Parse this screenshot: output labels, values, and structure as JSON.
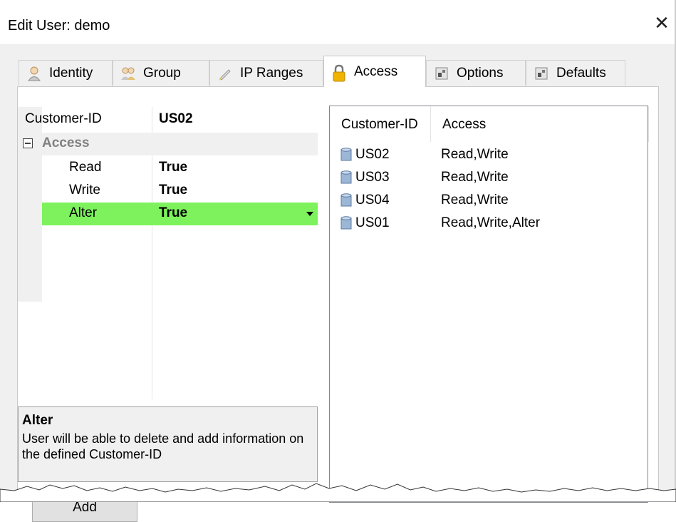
{
  "window": {
    "title": "Edit User: demo",
    "close_glyph": "✕"
  },
  "tabs": [
    {
      "label": "Identity",
      "icon": "person-icon",
      "selected": false
    },
    {
      "label": "Group",
      "icon": "group-icon",
      "selected": false
    },
    {
      "label": "IP Ranges",
      "icon": "pen-icon",
      "selected": false
    },
    {
      "label": "Access",
      "icon": "lock-icon",
      "selected": true
    },
    {
      "label": "Options",
      "icon": "settings-icon",
      "selected": false
    },
    {
      "label": "Defaults",
      "icon": "settings-icon",
      "selected": false
    }
  ],
  "property_grid": {
    "customer_id_label": "Customer-ID",
    "customer_id_value": "US02",
    "category": "Access",
    "rows": [
      {
        "name": "Read",
        "value": "True"
      },
      {
        "name": "Write",
        "value": "True"
      },
      {
        "name": "Alter",
        "value": "True"
      }
    ],
    "selected_row": "Alter",
    "selected_color": "#7df25c"
  },
  "help": {
    "title": "Alter",
    "description": "User will be able to delete and add information on the defined Customer-ID"
  },
  "buttons": {
    "add": "Add"
  },
  "list": {
    "columns": [
      "Customer-ID",
      "Access"
    ],
    "rows": [
      {
        "id": "US02",
        "access": "Read,Write"
      },
      {
        "id": "US03",
        "access": "Read,Write"
      },
      {
        "id": "US04",
        "access": "Read,Write"
      },
      {
        "id": "US01",
        "access": "Read,Write,Alter"
      }
    ]
  }
}
